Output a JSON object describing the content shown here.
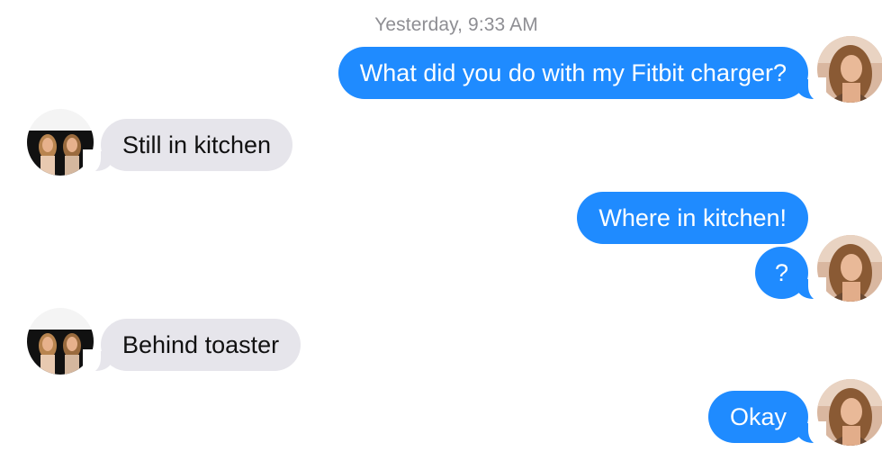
{
  "conversation": {
    "timestamp": "Yesterday, 9:33 AM",
    "messages": [
      {
        "sender": "me",
        "text": "What did you do with my Fitbit charger?"
      },
      {
        "sender": "them",
        "text": "Still in kitchen"
      },
      {
        "sender": "me",
        "text": "Where in kitchen!"
      },
      {
        "sender": "me",
        "text": "?"
      },
      {
        "sender": "them",
        "text": "Behind toaster"
      },
      {
        "sender": "me",
        "text": "Okay"
      }
    ]
  },
  "colors": {
    "outgoing_bubble": "#1f8bff",
    "incoming_bubble": "#e6e5eb",
    "timestamp_text": "#8e8e93",
    "background": "#ffffff"
  },
  "icons": {
    "self_avatar": "user-photo-avatar",
    "contact_avatar": "contact-photo-avatar"
  }
}
